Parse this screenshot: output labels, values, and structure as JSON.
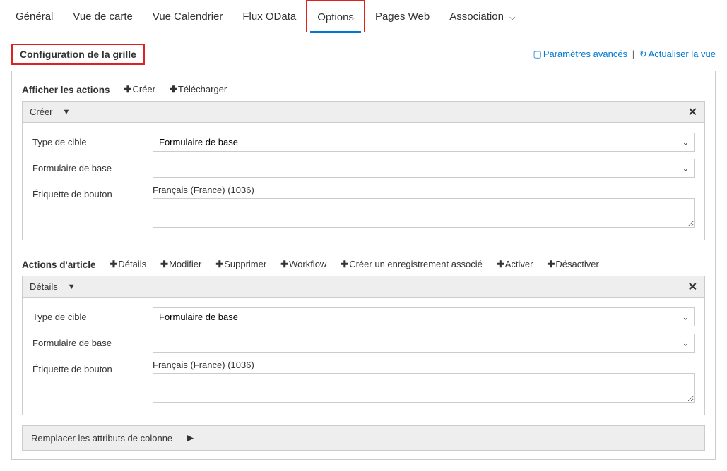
{
  "tabs": {
    "general": "Général",
    "map": "Vue de carte",
    "calendar": "Vue Calendrier",
    "odata": "Flux OData",
    "options": "Options",
    "webpages": "Pages Web",
    "association": "Association"
  },
  "heading": "Configuration de la grille",
  "headerLinks": {
    "advanced": "Paramètres avancés",
    "refresh": "Actualiser la vue"
  },
  "viewActions": {
    "title": "Afficher les actions",
    "create": "Créer",
    "download": "Télécharger"
  },
  "createPanel": {
    "title": "Créer",
    "fields": {
      "targetTypeLabel": "Type de cible",
      "targetTypeValue": "Formulaire de base",
      "baseFormLabel": "Formulaire de base",
      "baseFormValue": "",
      "buttonLabelLabel": "Étiquette de bouton",
      "languageLabel": "Français (France) (1036)",
      "buttonLabelValue": ""
    }
  },
  "itemActions": {
    "title": "Actions d'article",
    "details": "Détails",
    "modify": "Modifier",
    "delete": "Supprimer",
    "workflow": "Workflow",
    "createAssoc": "Créer un enregistrement associé",
    "activate": "Activer",
    "deactivate": "Désactiver"
  },
  "detailsPanel": {
    "title": "Détails",
    "fields": {
      "targetTypeLabel": "Type de cible",
      "targetTypeValue": "Formulaire de base",
      "baseFormLabel": "Formulaire de base",
      "baseFormValue": "",
      "buttonLabelLabel": "Étiquette de bouton",
      "languageLabel": "Français (France) (1036)",
      "buttonLabelValue": ""
    }
  },
  "replaceBar": "Remplacer les attributs de colonne"
}
